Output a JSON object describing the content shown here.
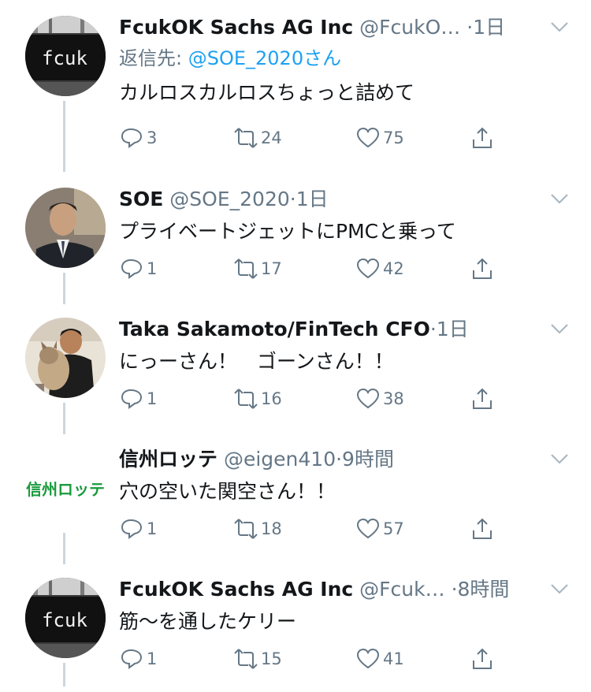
{
  "tweets": [
    {
      "name": "FcukOK Sachs AG Inc",
      "handle": "@FcukO…",
      "time": "·1日",
      "reply_prefix": "返信先: ",
      "reply_to": "@SOE_2020さん",
      "text": "カルロスカルロスちょっと詰めて",
      "replies": "3",
      "retweets": "24",
      "likes": "75",
      "avatar": {
        "type": "fcuk-logo",
        "logo_text": "fcuk"
      }
    },
    {
      "name": "SOE",
      "handle": "@SOE_2020",
      "time": "·1日",
      "text": "プライベートジェットにPMCと乗って",
      "replies": "1",
      "retweets": "17",
      "likes": "42",
      "avatar": {
        "type": "photo-man-suit"
      }
    },
    {
      "name": "Taka Sakamoto/FinTech CFO",
      "handle": "",
      "time": "·1日",
      "text": "にっーさん！　ゴーンさん！！",
      "replies": "1",
      "retweets": "16",
      "likes": "38",
      "avatar": {
        "type": "photo-man-cat"
      }
    },
    {
      "name": "信州ロッテ",
      "handle": "@eigen410",
      "time": "·9時間",
      "text": "穴の空いた関空さん！！",
      "replies": "1",
      "retweets": "18",
      "likes": "57",
      "avatar": {
        "type": "green-logo",
        "logo_text": "信州ロッテ",
        "color": "#1a9b3c"
      }
    },
    {
      "name": "FcukOK Sachs AG Inc",
      "handle": "@Fcuk…",
      "time": "·8時間",
      "text": "筋〜を通したケリー",
      "replies": "1",
      "retweets": "15",
      "likes": "41",
      "avatar": {
        "type": "fcuk-logo",
        "logo_text": "fcuk"
      }
    }
  ],
  "colors": {
    "name": "#14171a",
    "meta": "#657786",
    "mention": "#1da1f2",
    "thread": "#ccd6dd"
  }
}
